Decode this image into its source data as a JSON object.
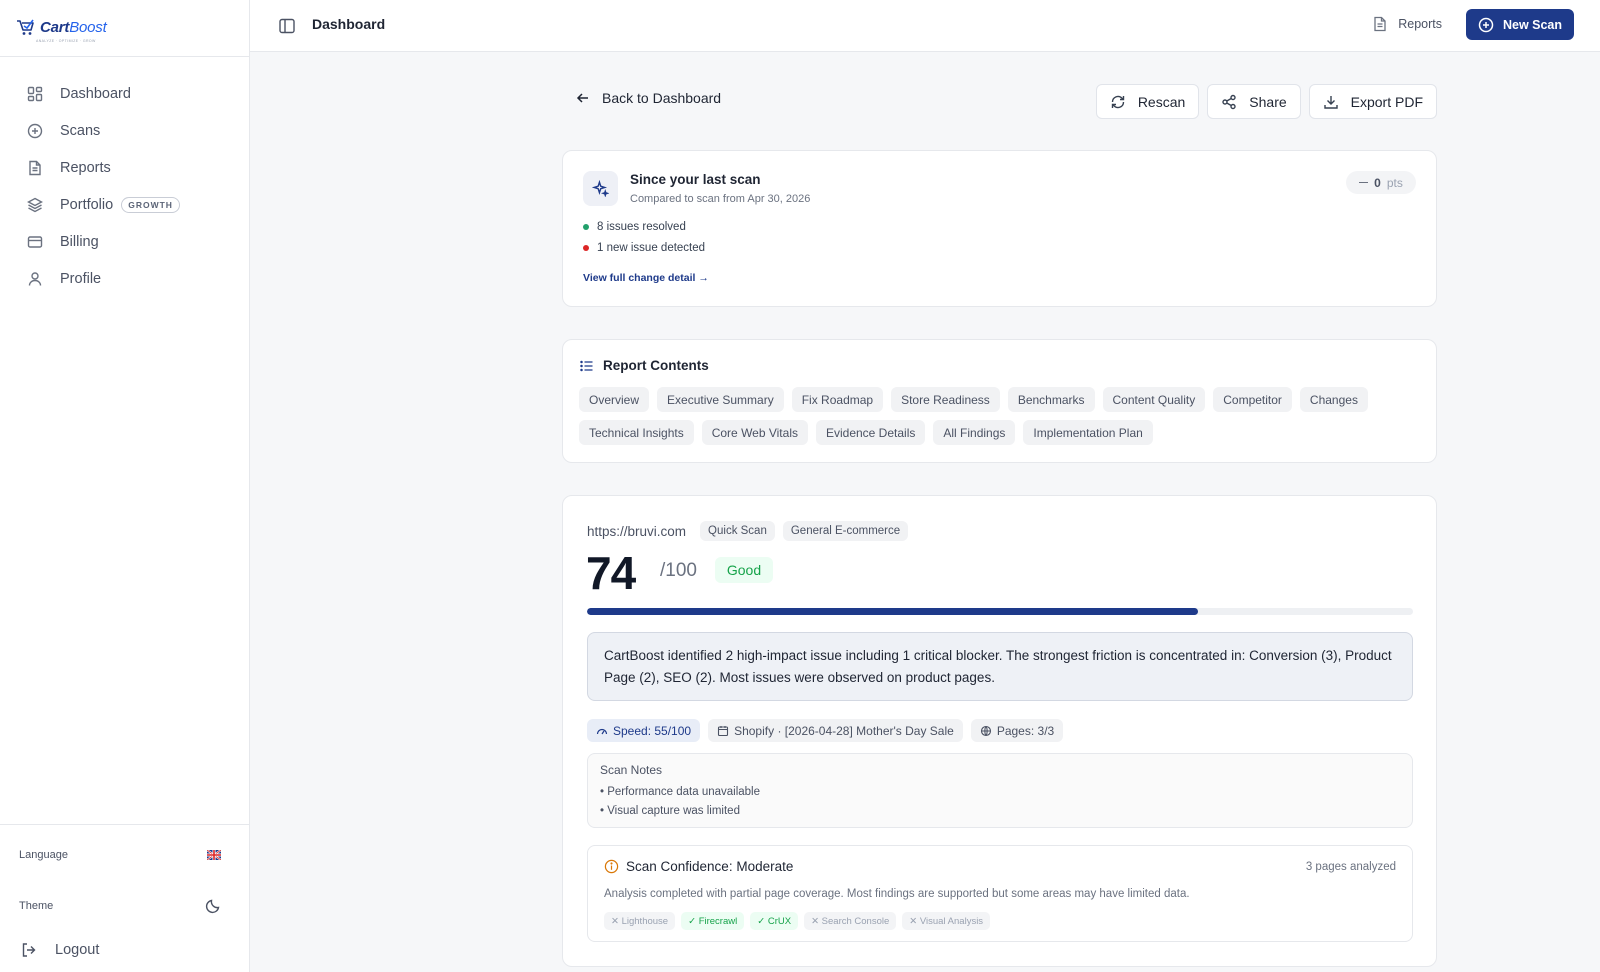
{
  "brand": {
    "name_part1": "Cart",
    "name_part2": "Boost",
    "tagline": "ANALYZE · OPTIMIZE · GROW"
  },
  "sidebar": {
    "items": [
      {
        "label": "Dashboard",
        "icon": "grid-icon"
      },
      {
        "label": "Scans",
        "icon": "plus-circle-icon"
      },
      {
        "label": "Reports",
        "icon": "file-text-icon"
      },
      {
        "label": "Portfolio",
        "icon": "layers-icon",
        "badge": "GROWTH"
      },
      {
        "label": "Billing",
        "icon": "credit-card-icon"
      },
      {
        "label": "Profile",
        "icon": "user-icon"
      }
    ],
    "language_label": "Language",
    "theme_label": "Theme",
    "logout_label": "Logout"
  },
  "topbar": {
    "title": "Dashboard",
    "reports_label": "Reports",
    "new_scan_label": "New Scan"
  },
  "actions": {
    "back_label": "Back to Dashboard",
    "rescan_label": "Rescan",
    "share_label": "Share",
    "export_label": "Export PDF"
  },
  "since_scan": {
    "title": "Since your last scan",
    "subtitle": "Compared to scan from Apr 30, 2026",
    "points_value": "0",
    "points_unit": "pts",
    "resolved": "8 issues resolved",
    "new_issue": "1 new issue detected",
    "link": "View full change detail →",
    "colors": {
      "resolved": "#22a06b",
      "new": "#dc2626"
    }
  },
  "report_contents": {
    "title": "Report Contents",
    "chips": [
      "Overview",
      "Executive Summary",
      "Fix Roadmap",
      "Store Readiness",
      "Benchmarks",
      "Content Quality",
      "Competitor",
      "Changes",
      "Technical Insights",
      "Core Web Vitals",
      "Evidence Details",
      "All Findings",
      "Implementation Plan"
    ]
  },
  "score": {
    "url": "https://bruvi.com",
    "tags": [
      "Quick Scan",
      "General E-commerce"
    ],
    "value": "74",
    "max": "/100",
    "rating": "Good",
    "progress_percent": 74,
    "summary": "CartBoost identified 2 high-impact issue including 1 critical blocker. The strongest friction is concentrated in: Conversion (3), Product Page (2), SEO (2). Most issues were observed on product pages.",
    "meta": {
      "speed": "Speed: 55/100",
      "platform": "Shopify · [2026-04-28] Mother's Day Sale",
      "pages": "Pages: 3/3"
    },
    "notes": {
      "title": "Scan Notes",
      "items": [
        "• Performance data unavailable",
        "• Visual capture was limited"
      ]
    },
    "confidence": {
      "title": "Scan Confidence: Moderate",
      "pages": "3 pages analyzed",
      "text": "Analysis completed with partial page coverage. Most findings are supported but some areas may have limited data.",
      "sources": [
        {
          "label": "✕ Lighthouse",
          "ok": false
        },
        {
          "label": "✓ Firecrawl",
          "ok": true
        },
        {
          "label": "✓ CrUX",
          "ok": true
        },
        {
          "label": "✕ Search Console",
          "ok": false
        },
        {
          "label": "✕ Visual Analysis",
          "ok": false
        }
      ]
    }
  },
  "colors": {
    "accent": "#1e3a8a",
    "good": "#16a34a",
    "warning": "#d97706"
  }
}
